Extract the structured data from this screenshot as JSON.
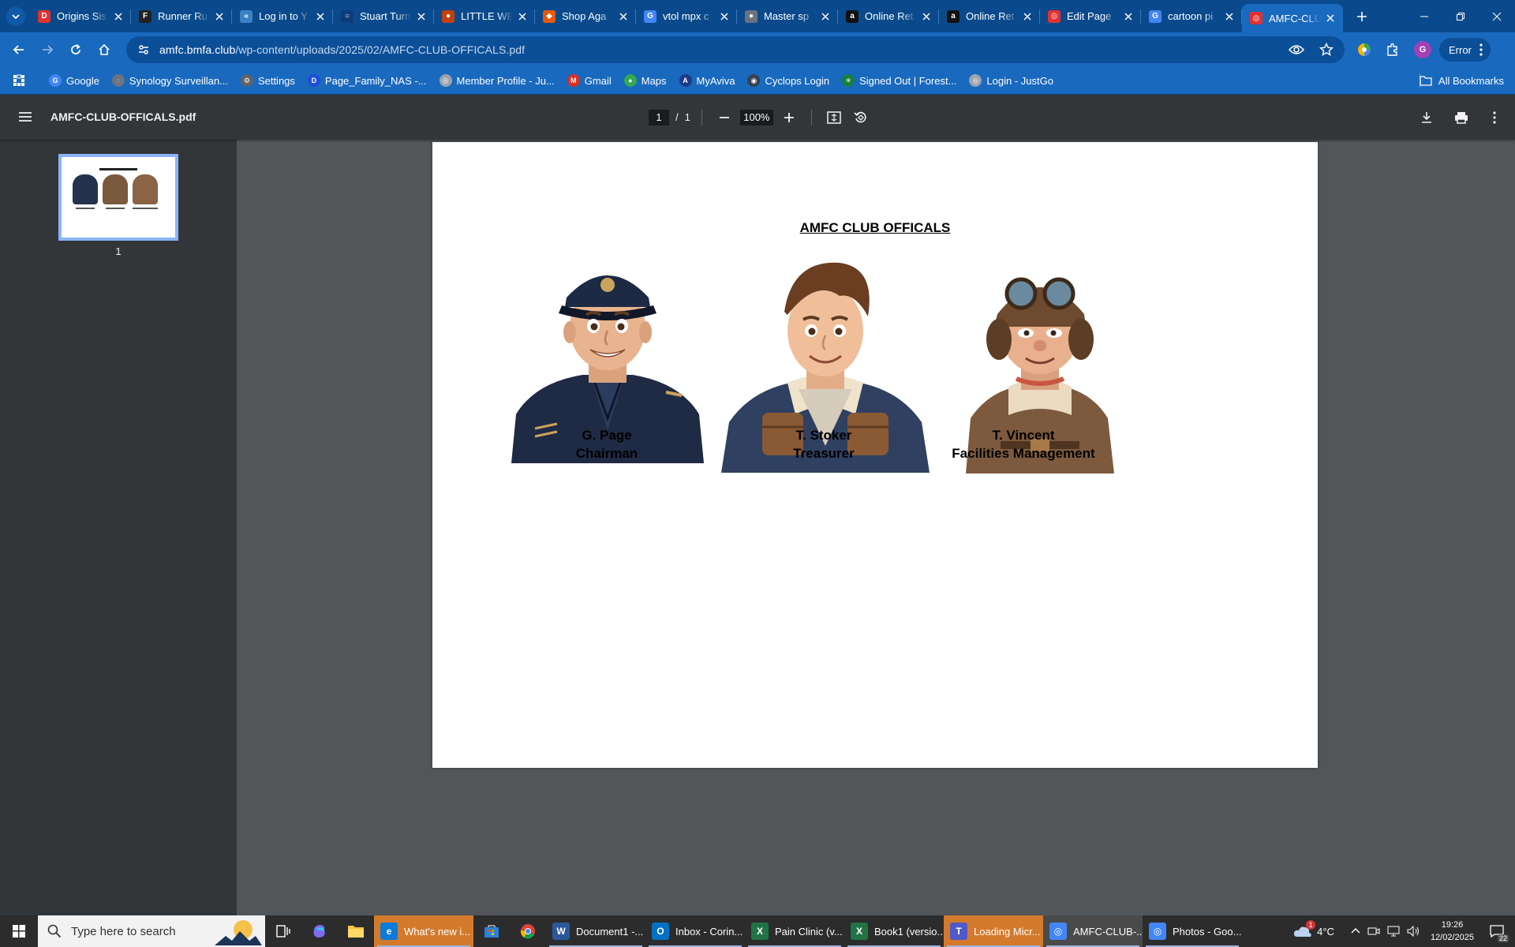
{
  "browser": {
    "tabs": [
      {
        "title": "Origins Sis",
        "favicon_text": "D",
        "favicon_color": "#e03131"
      },
      {
        "title": "Runner Ru",
        "favicon_text": "F",
        "favicon_color": "#222222"
      },
      {
        "title": "Log in to Y",
        "favicon_text": "«",
        "favicon_color": "#3b82c4"
      },
      {
        "title": "Stuart Turn",
        "favicon_text": "○",
        "favicon_color": "#0d3b7a"
      },
      {
        "title": "LITTLE WE",
        "favicon_text": "●",
        "favicon_color": "#c2410c"
      },
      {
        "title": "Shop Aga",
        "favicon_text": "◆",
        "favicon_color": "#e8590c"
      },
      {
        "title": "vtol mpx c",
        "favicon_text": "G",
        "favicon_color": "#4285f4"
      },
      {
        "title": "Master sp",
        "favicon_text": "●",
        "favicon_color": "#6b7280"
      },
      {
        "title": "Online Ret",
        "favicon_text": "a",
        "favicon_color": "#111111"
      },
      {
        "title": "Online Ret",
        "favicon_text": "a",
        "favicon_color": "#111111"
      },
      {
        "title": "Edit Page",
        "favicon_text": "◎",
        "favicon_color": "#e03131"
      },
      {
        "title": "cartoon pi",
        "favicon_text": "G",
        "favicon_color": "#4285f4"
      },
      {
        "title": "AMFC-CLU",
        "favicon_text": "◎",
        "favicon_color": "#e03131",
        "active": true
      }
    ],
    "address": {
      "host": "amfc.bmfa.club",
      "path": "/wp-content/uploads/2025/02/AMFC-CLUB-OFFICALS.pdf"
    },
    "profile_initial": "G",
    "error_label": "Error",
    "bookmarks": [
      {
        "label": "Google",
        "icon": "G",
        "color": "#4285f4"
      },
      {
        "label": "Synology Surveillan...",
        "icon": "◌",
        "color": "#6b7280"
      },
      {
        "label": "Settings",
        "icon": "⚙",
        "color": "#5f6368"
      },
      {
        "label": "Page_Family_NAS -...",
        "icon": "D",
        "color": "#1d4ed8"
      },
      {
        "label": "Member Profile - Ju...",
        "icon": "◎",
        "color": "#9ca3af"
      },
      {
        "label": "Gmail",
        "icon": "M",
        "color": "#d93025"
      },
      {
        "label": "Maps",
        "icon": "●",
        "color": "#34a853"
      },
      {
        "label": "MyAviva",
        "icon": "A",
        "color": "#1e3a8a"
      },
      {
        "label": "Cyclops Login",
        "icon": "◉",
        "color": "#374151"
      },
      {
        "label": "Signed Out | Forest...",
        "icon": "✳",
        "color": "#15803d"
      },
      {
        "label": "Login - JustGo",
        "icon": "◎",
        "color": "#9ca3af"
      }
    ],
    "all_bookmarks_label": "All Bookmarks"
  },
  "pdf": {
    "filename": "AMFC-CLUB-OFFICALS.pdf",
    "current_page": "1",
    "page_separator": "/",
    "total_pages": "1",
    "zoom": "100%",
    "thumbnail_label": "1",
    "document": {
      "title": "AMFC CLUB OFFICALS",
      "officials": [
        {
          "name": "G. Page",
          "role": "Chairman"
        },
        {
          "name": "T. Stoker",
          "role": "Treasurer"
        },
        {
          "name": "T. Vincent",
          "role": "Facilities Management"
        }
      ]
    }
  },
  "taskbar": {
    "search_placeholder": "Type here to search",
    "apps": [
      {
        "label": "What's new i...",
        "icon": "e",
        "color": "#0c7bd8",
        "style": "orange"
      },
      {
        "label": "Document1 -...",
        "icon": "W",
        "color": "#2b579a"
      },
      {
        "label": "Inbox - Corin...",
        "icon": "O",
        "color": "#0072c6"
      },
      {
        "label": "Pain Clinic (v...",
        "icon": "X",
        "color": "#217346"
      },
      {
        "label": "Book1 (versio...",
        "icon": "X",
        "color": "#217346"
      },
      {
        "label": "Loading Micr...",
        "icon": "T",
        "color": "#5059c9",
        "style": "orange"
      },
      {
        "label": "AMFC-CLUB-...",
        "icon": "◎",
        "color": "#4285f4",
        "style": "focus"
      },
      {
        "label": "Photos - Goo...",
        "icon": "◎",
        "color": "#4285f4"
      }
    ],
    "weather": "4°C",
    "time": "19:26",
    "date": "12/02/2025",
    "notifications": "22",
    "weather_badge": "1"
  }
}
